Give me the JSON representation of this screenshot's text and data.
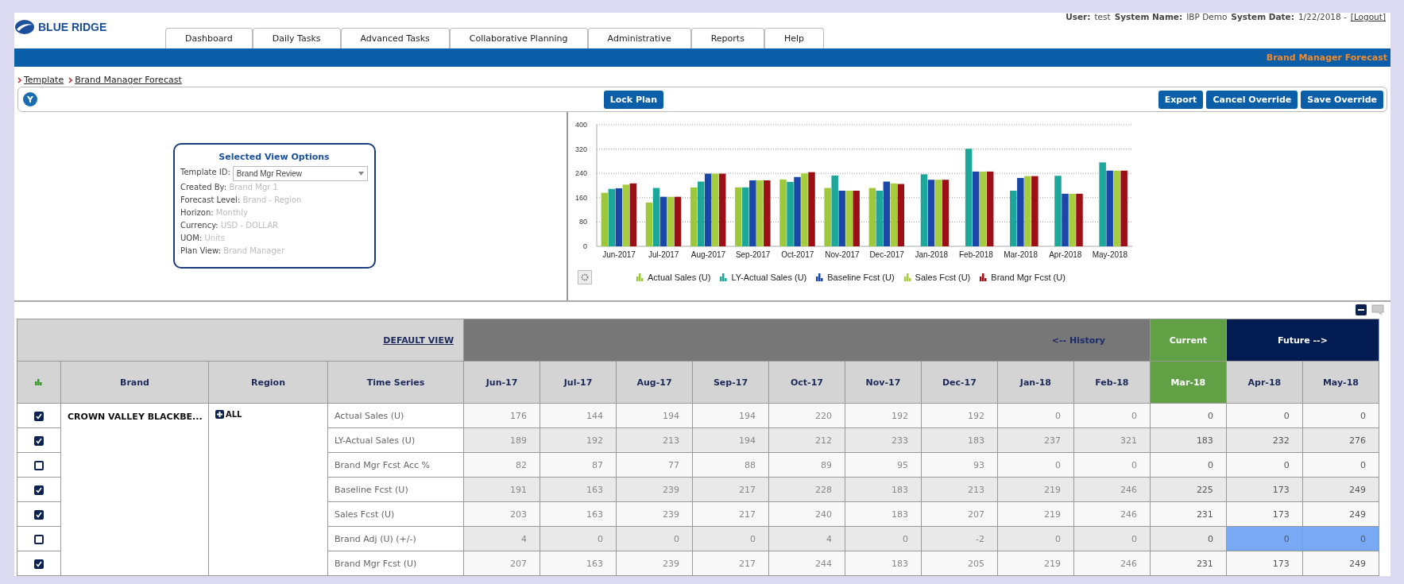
{
  "logo": {
    "text": "BLUE RIDGE"
  },
  "user_info": [
    {
      "label": "User:",
      "value": "test"
    },
    {
      "label": "System Name:",
      "value": "IBP Demo"
    },
    {
      "label": "System Date:",
      "value": "1/22/2018 -"
    }
  ],
  "logout": {
    "label": "[Logout]"
  },
  "tabs": [
    {
      "label": "Dashboard",
      "selected": false
    },
    {
      "label": "Daily Tasks",
      "selected": false
    },
    {
      "label": "Advanced Tasks",
      "selected": false
    },
    {
      "label": "Collaborative Planning",
      "selected": false
    },
    {
      "label": "Administrative",
      "selected": false
    },
    {
      "label": "Reports",
      "selected": false
    },
    {
      "label": "Help",
      "selected": false
    }
  ],
  "page_title": "Brand Manager Forecast",
  "breadcrumb": [
    "Template",
    "Brand Manager Forecast"
  ],
  "toolbar": {
    "badge": "Y",
    "center_buttons": [
      "Lock Plan"
    ],
    "right_buttons": [
      "Export",
      "Cancel Override",
      "Save Override"
    ]
  },
  "view_options": {
    "title": "Selected View Options",
    "template_label": "Template ID:",
    "template_value": "Brand Mgr Review",
    "fields": [
      {
        "label": "Created By:",
        "value": "Brand Mgr 1"
      },
      {
        "label": "Forecast Level:",
        "value": "Brand - Region"
      },
      {
        "label": "Horizon:",
        "value": "Monthly"
      },
      {
        "label": "Currency:",
        "value": "USD - DOLLAR"
      },
      {
        "label": "UOM:",
        "value": "Units"
      },
      {
        "label": "Plan View:",
        "value": "Brand Manager"
      }
    ]
  },
  "chart_data": {
    "type": "bar",
    "grid": true,
    "legend": true,
    "categories": [
      "Jun-2017",
      "Jul-2017",
      "Aug-2017",
      "Sep-2017",
      "Oct-2017",
      "Nov-2017",
      "Dec-2017",
      "Jan-2018",
      "Feb-2018",
      "Mar-2018",
      "Apr-2018",
      "May-2018"
    ],
    "ylim": [
      0,
      400
    ],
    "yticks": [
      0,
      80,
      160,
      240,
      320,
      400
    ],
    "series": [
      {
        "name": "Actual Sales (U)",
        "color": "#9dc83a",
        "values": [
          176,
          144,
          194,
          194,
          220,
          192,
          192,
          0,
          0,
          0,
          0,
          0
        ]
      },
      {
        "name": "LY-Actual Sales (U)",
        "color": "#1ba89a",
        "values": [
          189,
          192,
          213,
          194,
          212,
          233,
          183,
          237,
          321,
          183,
          232,
          276
        ]
      },
      {
        "name": "Baseline Fcst (U)",
        "color": "#1b48a8",
        "values": [
          191,
          163,
          239,
          217,
          228,
          183,
          213,
          219,
          246,
          225,
          173,
          249
        ]
      },
      {
        "name": "Sales Fcst (U)",
        "color": "#a5cd3e",
        "values": [
          203,
          163,
          239,
          217,
          240,
          183,
          207,
          219,
          246,
          231,
          173,
          249
        ]
      },
      {
        "name": "Brand Mgr Fcst (U)",
        "color": "#9c0f16",
        "values": [
          207,
          163,
          239,
          217,
          244,
          183,
          205,
          219,
          246,
          231,
          173,
          249
        ]
      }
    ]
  },
  "grid": {
    "default_view": "DEFAULT VIEW",
    "groups": [
      {
        "label": "<-- History",
        "kind": "history"
      },
      {
        "label": "Current",
        "kind": "current"
      },
      {
        "label": "Future -->",
        "kind": "future"
      }
    ],
    "columns": [
      {
        "label": "Brand",
        "kind": "key"
      },
      {
        "label": "Region",
        "kind": "hierarchy"
      },
      {
        "label": "Time Series",
        "kind": "series"
      },
      {
        "label": "Jun-17",
        "kind": "history"
      },
      {
        "label": "Jul-17",
        "kind": "history"
      },
      {
        "label": "Aug-17",
        "kind": "history"
      },
      {
        "label": "Sep-17",
        "kind": "history"
      },
      {
        "label": "Oct-17",
        "kind": "history"
      },
      {
        "label": "Nov-17",
        "kind": "history"
      },
      {
        "label": "Dec-17",
        "kind": "history"
      },
      {
        "label": "Jan-18",
        "kind": "history"
      },
      {
        "label": "Feb-18",
        "kind": "history"
      },
      {
        "label": "Mar-18",
        "kind": "current"
      },
      {
        "label": "Apr-18",
        "kind": "future"
      },
      {
        "label": "May-18",
        "kind": "future"
      }
    ],
    "rows": [
      {
        "checked": true,
        "cells": [
          {
            "value": "CROWN VALLEY BLACKBE...",
            "rowspan": 7
          },
          {
            "value": "ALL",
            "rowspan": 7
          },
          {
            "value": "Actual Sales (U)"
          },
          {
            "value": "176",
            "selected": false
          },
          {
            "value": "144",
            "selected": false
          },
          {
            "value": "194",
            "selected": false
          },
          {
            "value": "194",
            "selected": false
          },
          {
            "value": "220",
            "selected": false
          },
          {
            "value": "192",
            "selected": false
          },
          {
            "value": "192",
            "selected": false
          },
          {
            "value": "0",
            "selected": false
          },
          {
            "value": "0",
            "selected": false
          },
          {
            "value": "0",
            "selected": false
          },
          {
            "value": "0",
            "selected": false
          },
          {
            "value": "0",
            "selected": false
          }
        ]
      },
      {
        "checked": true,
        "cells": [
          {
            "value": "LY-Actual Sales (U)"
          },
          {
            "value": "189",
            "selected": false
          },
          {
            "value": "192",
            "selected": false
          },
          {
            "value": "213",
            "selected": false
          },
          {
            "value": "194",
            "selected": false
          },
          {
            "value": "212",
            "selected": false
          },
          {
            "value": "233",
            "selected": false
          },
          {
            "value": "183",
            "selected": false
          },
          {
            "value": "237",
            "selected": false
          },
          {
            "value": "321",
            "selected": false
          },
          {
            "value": "183",
            "selected": false
          },
          {
            "value": "232",
            "selected": false
          },
          {
            "value": "276",
            "selected": false
          }
        ]
      },
      {
        "checked": false,
        "cells": [
          {
            "value": "Brand Mgr Fcst Acc %"
          },
          {
            "value": "82",
            "selected": false
          },
          {
            "value": "87",
            "selected": false
          },
          {
            "value": "77",
            "selected": false
          },
          {
            "value": "88",
            "selected": false
          },
          {
            "value": "89",
            "selected": false
          },
          {
            "value": "95",
            "selected": false
          },
          {
            "value": "93",
            "selected": false
          },
          {
            "value": "0",
            "selected": false
          },
          {
            "value": "0",
            "selected": false
          },
          {
            "value": "0",
            "selected": false
          },
          {
            "value": "0",
            "selected": false
          },
          {
            "value": "0",
            "selected": false
          }
        ]
      },
      {
        "checked": true,
        "cells": [
          {
            "value": "Baseline Fcst (U)"
          },
          {
            "value": "191",
            "selected": false
          },
          {
            "value": "163",
            "selected": false
          },
          {
            "value": "239",
            "selected": false
          },
          {
            "value": "217",
            "selected": false
          },
          {
            "value": "228",
            "selected": false
          },
          {
            "value": "183",
            "selected": false
          },
          {
            "value": "213",
            "selected": false
          },
          {
            "value": "219",
            "selected": false
          },
          {
            "value": "246",
            "selected": false
          },
          {
            "value": "225",
            "selected": false
          },
          {
            "value": "173",
            "selected": false
          },
          {
            "value": "249",
            "selected": false
          }
        ]
      },
      {
        "checked": true,
        "cells": [
          {
            "value": "Sales Fcst (U)"
          },
          {
            "value": "203",
            "selected": false
          },
          {
            "value": "163",
            "selected": false
          },
          {
            "value": "239",
            "selected": false
          },
          {
            "value": "217",
            "selected": false
          },
          {
            "value": "240",
            "selected": false
          },
          {
            "value": "183",
            "selected": false
          },
          {
            "value": "207",
            "selected": false
          },
          {
            "value": "219",
            "selected": false
          },
          {
            "value": "246",
            "selected": false
          },
          {
            "value": "231",
            "selected": false
          },
          {
            "value": "173",
            "selected": false
          },
          {
            "value": "249",
            "selected": false
          }
        ]
      },
      {
        "checked": false,
        "cells": [
          {
            "value": "Brand Adj (U) (+/-)"
          },
          {
            "value": "4",
            "selected": false
          },
          {
            "value": "0",
            "selected": false
          },
          {
            "value": "0",
            "selected": false
          },
          {
            "value": "0",
            "selected": false
          },
          {
            "value": "4",
            "selected": false
          },
          {
            "value": "0",
            "selected": false
          },
          {
            "value": "-2",
            "selected": false
          },
          {
            "value": "0",
            "selected": false
          },
          {
            "value": "0",
            "selected": false
          },
          {
            "value": "0",
            "selected": false
          },
          {
            "value": "0",
            "selected": true
          },
          {
            "value": "0",
            "selected": true
          }
        ]
      },
      {
        "checked": true,
        "cells": [
          {
            "value": "Brand Mgr Fcst (U)"
          },
          {
            "value": "207",
            "selected": false
          },
          {
            "value": "163",
            "selected": false
          },
          {
            "value": "239",
            "selected": false
          },
          {
            "value": "217",
            "selected": false
          },
          {
            "value": "244",
            "selected": false
          },
          {
            "value": "183",
            "selected": false
          },
          {
            "value": "205",
            "selected": false
          },
          {
            "value": "219",
            "selected": false
          },
          {
            "value": "246",
            "selected": false
          },
          {
            "value": "231",
            "selected": false
          },
          {
            "value": "173",
            "selected": false
          },
          {
            "value": "249",
            "selected": false
          }
        ]
      }
    ]
  }
}
